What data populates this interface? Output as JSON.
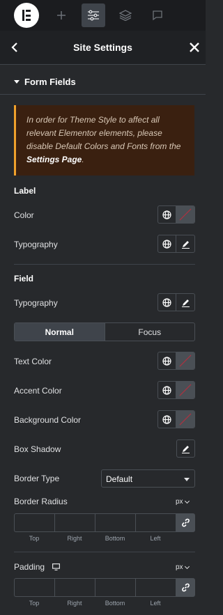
{
  "topbar": {
    "icons": [
      "elementor-logo-icon",
      "plus-icon",
      "sliders-icon",
      "layers-icon",
      "comment-icon"
    ]
  },
  "header": {
    "title": "Site Settings"
  },
  "section": {
    "title": "Form Fields"
  },
  "alert": {
    "text": "In order for Theme Style to affect all relevant Elementor elements, please disable Default Colors and Fonts from the ",
    "link": "Settings Page",
    "end": "."
  },
  "label_group": {
    "heading": "Label",
    "color": "Color",
    "typography": "Typography"
  },
  "field_group": {
    "heading": "Field",
    "typography": "Typography",
    "tabs": [
      "Normal",
      "Focus"
    ],
    "active_tab": "Normal",
    "text_color": "Text Color",
    "accent_color": "Accent Color",
    "background_color": "Background Color",
    "box_shadow": "Box Shadow",
    "border_type": {
      "label": "Border Type",
      "value": "Default"
    },
    "border_radius": {
      "label": "Border Radius",
      "unit": "px",
      "sides": [
        "Top",
        "Right",
        "Bottom",
        "Left"
      ]
    }
  },
  "padding": {
    "label": "Padding",
    "unit": "px",
    "sides": [
      "Top",
      "Right",
      "Bottom",
      "Left"
    ]
  },
  "colors": {
    "accent": "#f0a12c",
    "panel": "#27292c",
    "unset_slash": "#b0313f"
  }
}
